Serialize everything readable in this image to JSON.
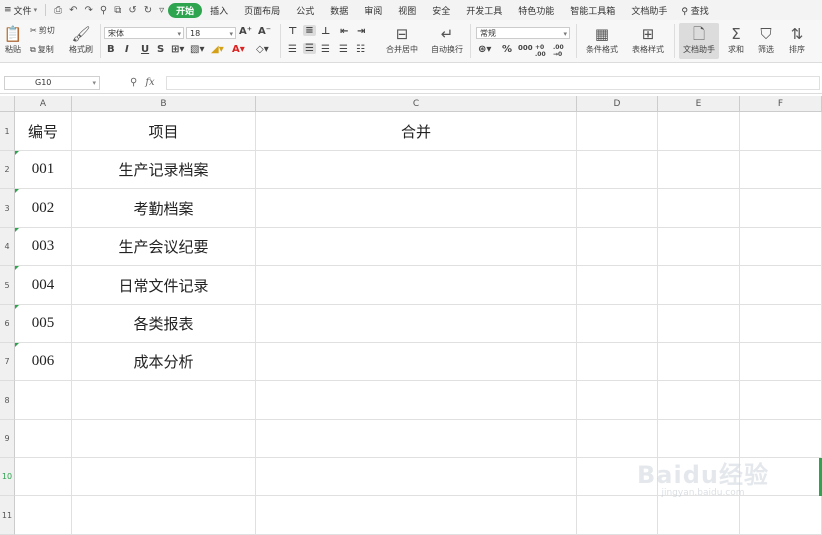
{
  "menubar": {
    "menu_icon": "≡",
    "file_label": "文件",
    "quick_icons": [
      "⎙",
      "↶",
      "↷",
      "⚲",
      "⧉",
      "↺",
      "↻",
      "▿"
    ],
    "tabs": [
      {
        "label": "开始",
        "active": true
      },
      {
        "label": "插入"
      },
      {
        "label": "页面布局"
      },
      {
        "label": "公式"
      },
      {
        "label": "数据"
      },
      {
        "label": "审阅"
      },
      {
        "label": "视图"
      },
      {
        "label": "安全"
      },
      {
        "label": "开发工具"
      },
      {
        "label": "特色功能"
      },
      {
        "label": "智能工具箱"
      },
      {
        "label": "文档助手"
      }
    ],
    "search_label": "查找",
    "active_color": "#2ea44f"
  },
  "ribbon": {
    "paste": "粘贴",
    "cut": "剪切",
    "copy": "复制",
    "format_painter": "格式刷",
    "font_name": "宋体",
    "font_size": "18",
    "grow_font": "A⁺",
    "shrink_font": "A⁻",
    "bold": "B",
    "italic": "I",
    "underline": "U",
    "strike": "S",
    "merge_center": "合并居中",
    "auto_wrap": "自动换行",
    "number_format": "常规",
    "percent": "%",
    "thousands": "000",
    "inc_decimal": "+0 .00",
    "dec_decimal": ".00 →0",
    "conditional_format": "条件格式",
    "table_style": "表格样式",
    "doc_assistant": "文档助手",
    "sum": "求和",
    "filter": "筛选",
    "sort": "排序"
  },
  "formula_bar": {
    "cell_ref": "G10",
    "fx": "fx",
    "value": ""
  },
  "sheet": {
    "columns": [
      "A",
      "B",
      "C",
      "D",
      "E",
      "F"
    ],
    "rows": [
      "1",
      "2",
      "3",
      "4",
      "5",
      "6",
      "7",
      "8",
      "9",
      "10",
      "11"
    ],
    "selected_row": "10",
    "headers": {
      "a": "编号",
      "b": "项目",
      "c": "合并"
    },
    "data": [
      {
        "a": "001",
        "b": "生产记录档案"
      },
      {
        "a": "002",
        "b": "考勤档案"
      },
      {
        "a": "003",
        "b": "生产会议纪要"
      },
      {
        "a": "004",
        "b": "日常文件记录"
      },
      {
        "a": "005",
        "b": "各类报表"
      },
      {
        "a": "006",
        "b": "成本分析"
      }
    ]
  },
  "watermark": {
    "line1": "Baidu经验",
    "line2": "jingyan.baidu.com"
  }
}
